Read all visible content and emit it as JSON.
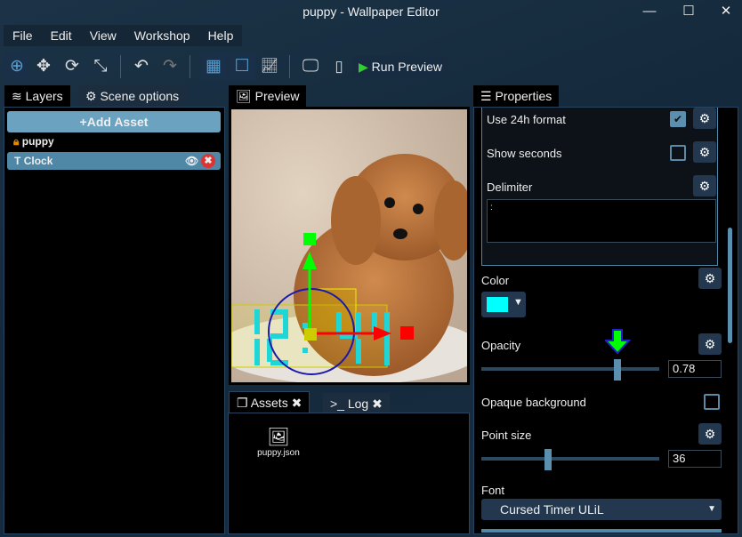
{
  "window": {
    "title": "puppy - Wallpaper Editor",
    "minimize": "—",
    "maximize": "☐",
    "close": "✕"
  },
  "menu": [
    "File",
    "Edit",
    "View",
    "Workshop",
    "Help"
  ],
  "toolbar": {
    "run_preview": "Run Preview"
  },
  "left": {
    "tabs": [
      "Layers",
      "Scene options"
    ],
    "add_asset": "Add Asset",
    "layers": [
      {
        "name": "puppy",
        "locked": true
      },
      {
        "name": "Clock",
        "selected": true
      }
    ]
  },
  "preview": {
    "tab": "Preview"
  },
  "bottom": {
    "tabs": [
      "Assets",
      "Log"
    ],
    "assets": [
      {
        "name": "puppy.json",
        "icon": "image-icon"
      }
    ]
  },
  "properties": {
    "tab": "Properties",
    "use24h": {
      "label": "Use 24h format",
      "checked": true
    },
    "show_seconds": {
      "label": "Show seconds",
      "checked": false
    },
    "delimiter": {
      "label": "Delimiter",
      "value": ":"
    },
    "color": {
      "label": "Color",
      "value": "#00ffff"
    },
    "opacity": {
      "label": "Opacity",
      "value": "0.78",
      "fraction": 0.78
    },
    "opaque_bg": {
      "label": "Opaque background",
      "checked": false
    },
    "point_size": {
      "label": "Point size",
      "value": "36",
      "fraction": 0.37
    },
    "font": {
      "label": "Font",
      "value": "Cursed Timer ULiL"
    }
  },
  "colors": {
    "accent": "#5b8fb0",
    "highlight": "#00ff00",
    "clock": "#00e5e5"
  }
}
